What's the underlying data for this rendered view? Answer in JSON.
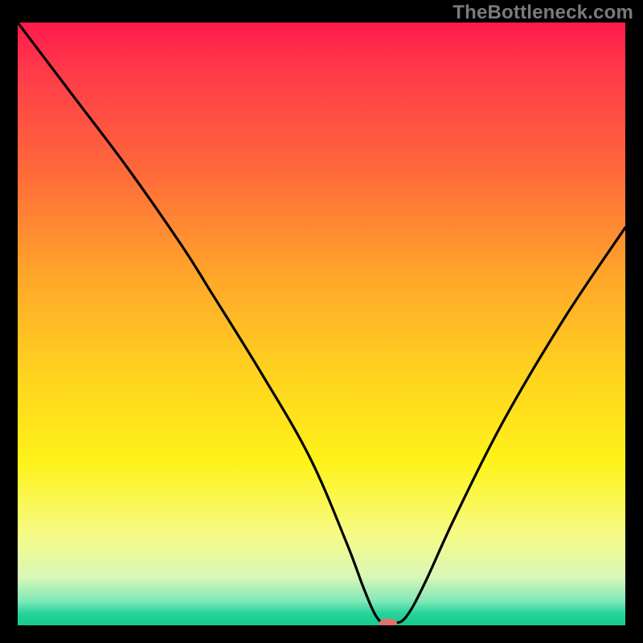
{
  "watermark": "TheBottleneck.com",
  "chart_data": {
    "type": "line",
    "title": "",
    "xlabel": "",
    "ylabel": "",
    "xlim": [
      0,
      100
    ],
    "ylim": [
      0,
      100
    ],
    "grid": false,
    "legend": false,
    "background": "red-yellow-green vertical gradient (bottleneck heatmap)",
    "series": [
      {
        "name": "bottleneck-curve",
        "x": [
          0,
          9,
          18,
          27,
          32,
          40,
          48,
          54,
          57,
          59,
          60.5,
          62,
          64,
          67,
          72,
          80,
          90,
          100
        ],
        "values": [
          100,
          88,
          76,
          63,
          55,
          42,
          28,
          14,
          6,
          1.5,
          0.3,
          0.3,
          1.5,
          7,
          18,
          34,
          51,
          66
        ]
      }
    ],
    "optimal_marker": {
      "x": 61,
      "y": 0.3
    },
    "colors": {
      "curve": "#000000",
      "marker": "#e0726b",
      "gradient_top": "#ff1a4b",
      "gradient_mid": "#ffd21f",
      "gradient_bottom": "#17c98f",
      "frame": "#000000",
      "watermark": "#7a7a7a"
    }
  }
}
